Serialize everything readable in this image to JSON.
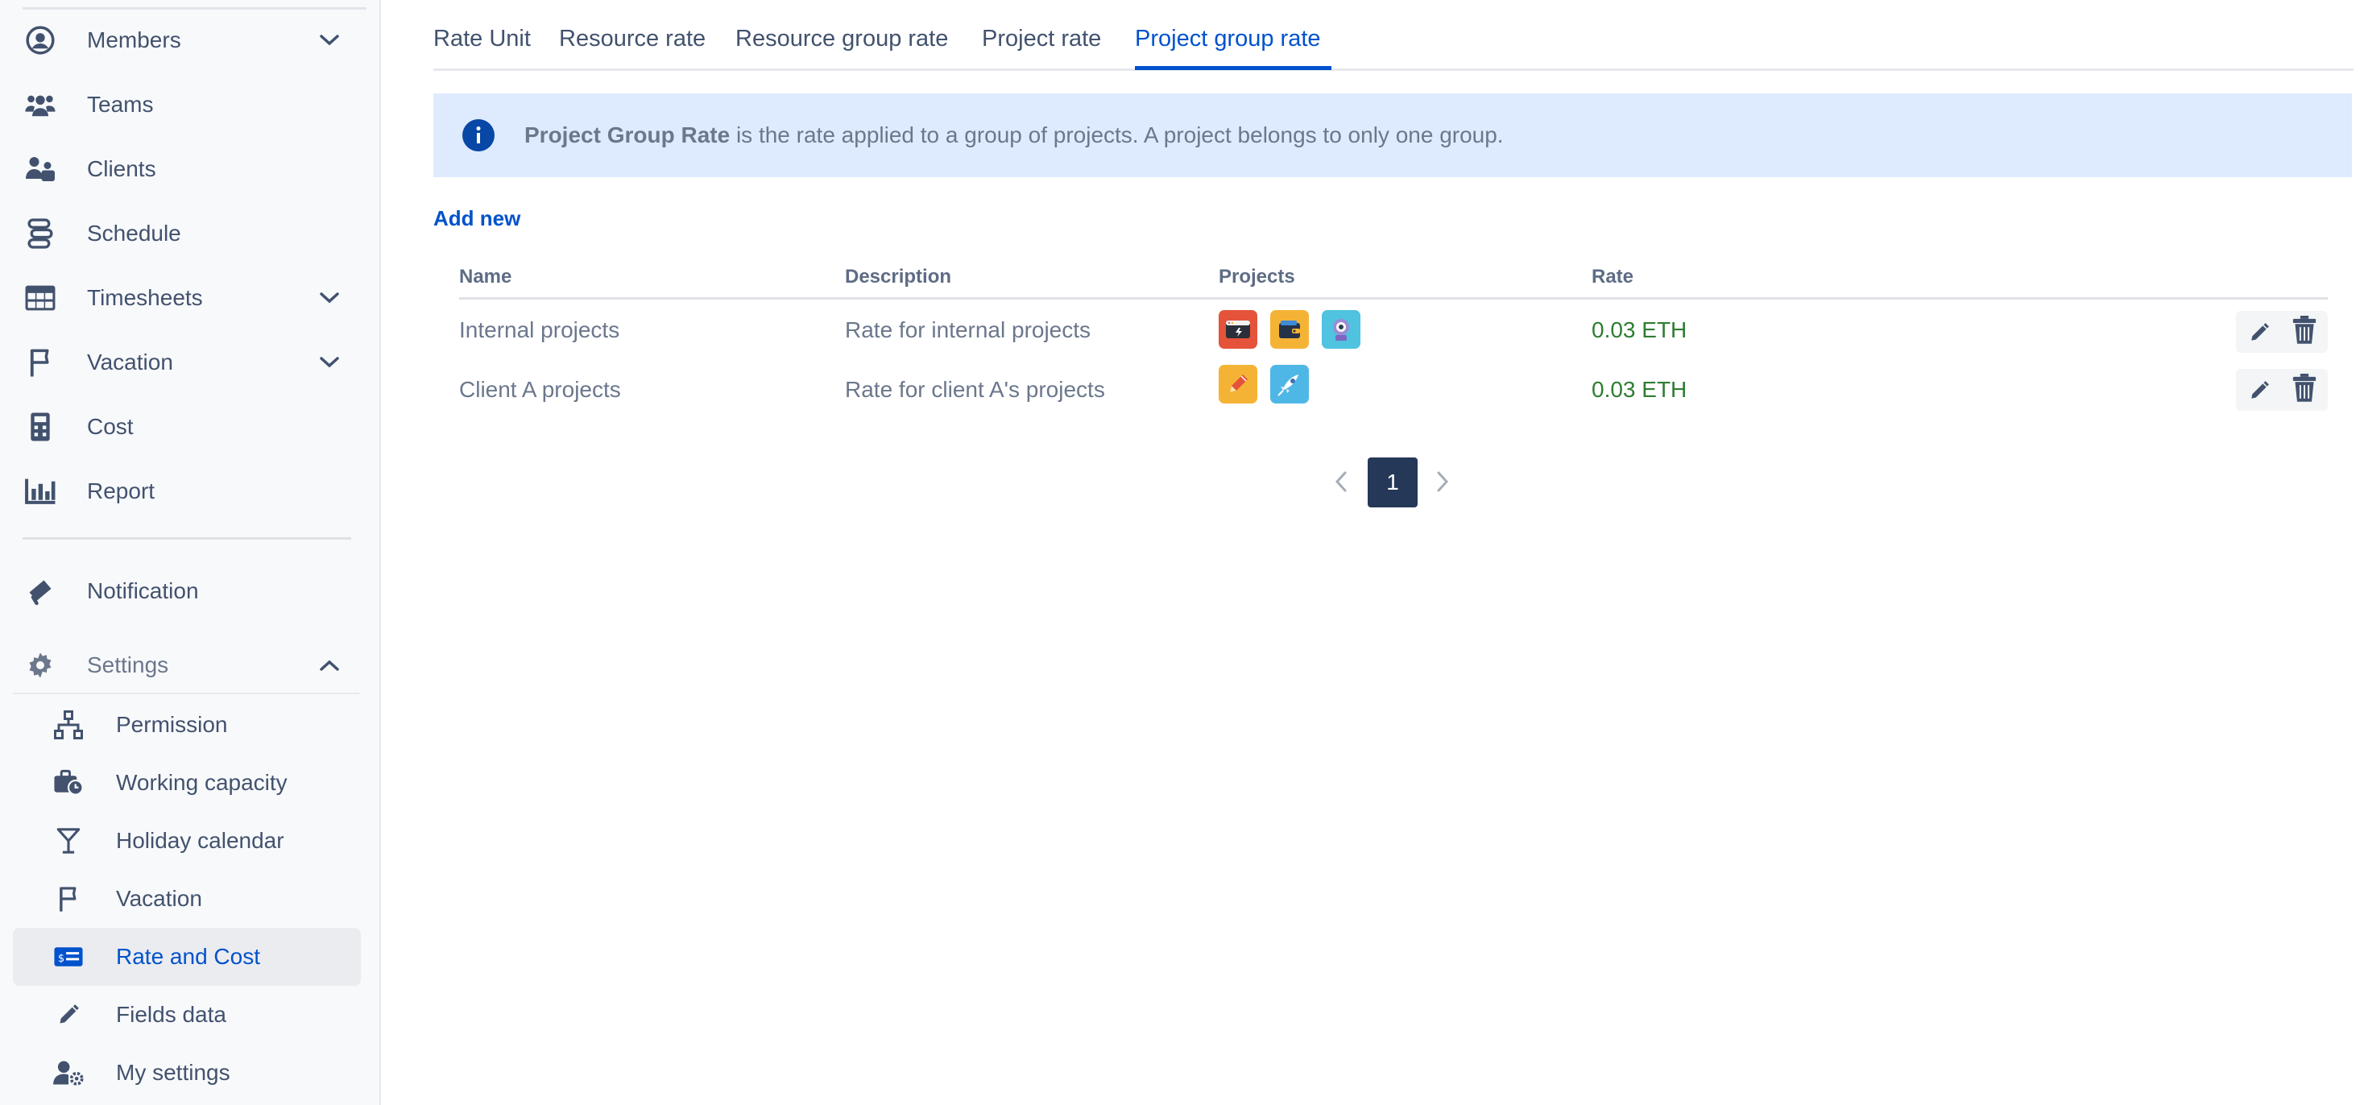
{
  "sidebar": {
    "nav": [
      {
        "label": "Members",
        "icon": "user-circle-icon"
      },
      {
        "label": "Teams",
        "icon": "users-icon"
      },
      {
        "label": "Clients",
        "icon": "clients-icon"
      },
      {
        "label": "Schedule",
        "icon": "schedule-icon"
      },
      {
        "label": "Timesheets",
        "icon": "table-icon"
      },
      {
        "label": "Vacation",
        "icon": "flag-icon"
      },
      {
        "label": "Cost",
        "icon": "calculator-icon"
      },
      {
        "label": "Report",
        "icon": "bar-chart-icon"
      },
      {
        "label": "Notification",
        "icon": "bullhorn-icon"
      },
      {
        "label": "Settings",
        "icon": "gear-icon"
      }
    ],
    "settings_items": [
      {
        "label": "Permission",
        "icon": "sitemap-icon"
      },
      {
        "label": "Working capacity",
        "icon": "briefcase-clock-icon"
      },
      {
        "label": "Holiday calendar",
        "icon": "cocktail-icon"
      },
      {
        "label": "Vacation",
        "icon": "flag-icon"
      },
      {
        "label": "Rate and Cost",
        "icon": "money-card-icon",
        "active": true
      },
      {
        "label": "Fields data",
        "icon": "pencil-icon"
      },
      {
        "label": "My settings",
        "icon": "user-gear-icon"
      }
    ]
  },
  "tabs": [
    {
      "label": "Rate Unit"
    },
    {
      "label": "Resource rate"
    },
    {
      "label": "Resource group rate"
    },
    {
      "label": "Project rate"
    },
    {
      "label": "Project group rate",
      "active": true
    }
  ],
  "banner": {
    "bold": "Project Group Rate",
    "text": " is the rate applied to a group of projects. A project belongs to only one group."
  },
  "add_new_label": "Add new",
  "table": {
    "headers": {
      "name": "Name",
      "description": "Description",
      "projects": "Projects",
      "rate": "Rate"
    },
    "rows": [
      {
        "name": "Internal projects",
        "description": "Rate for internal projects",
        "rate": "0.03 ETH",
        "projects": [
          "browser-app-icon",
          "wallet-app-icon",
          "robot-app-icon"
        ]
      },
      {
        "name": "Client A projects",
        "description": "Rate for client A's projects",
        "rate": "0.03 ETH",
        "projects": [
          "pen-app-icon",
          "rocket-app-icon"
        ]
      }
    ]
  },
  "pagination": {
    "current": "1"
  },
  "colors": {
    "accent": "#0052cc",
    "rate": "#2e7d32",
    "banner": "#deebff",
    "page_active": "#253858"
  }
}
